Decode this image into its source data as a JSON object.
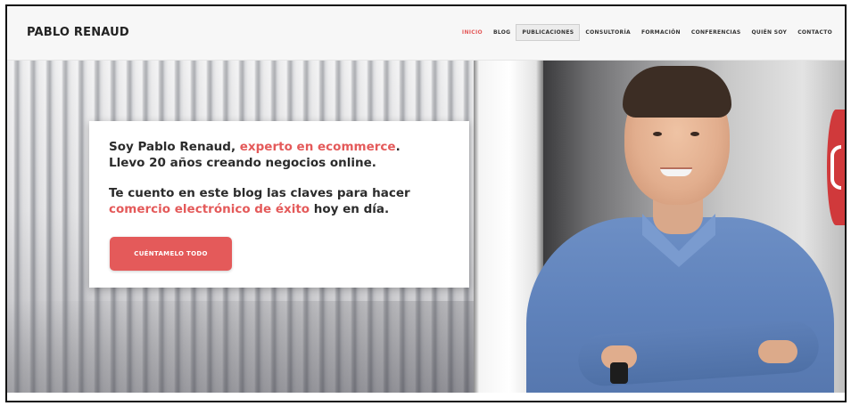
{
  "header": {
    "logo": "PABLO RENAUD",
    "nav": [
      {
        "label": "INICIO",
        "state": "active"
      },
      {
        "label": "BLOG",
        "state": "normal"
      },
      {
        "label": "PUBLICACIONES",
        "state": "hover"
      },
      {
        "label": "CONSULTORÍA",
        "state": "normal"
      },
      {
        "label": "FORMACIÓN",
        "state": "normal"
      },
      {
        "label": "CONFERENCIAS",
        "state": "normal"
      },
      {
        "label": "QUIÉN SOY",
        "state": "normal"
      },
      {
        "label": "CONTACTO",
        "state": "normal"
      }
    ]
  },
  "hero": {
    "line1_prefix": "Soy Pablo Renaud, ",
    "line1_accent": "experto en ecommerce",
    "line1_suffix": ".",
    "line2": "Llevo 20 años creando negocios online.",
    "line3": "Te cuento en este blog las claves para hacer",
    "line4_accent": "comercio electrónico de éxito",
    "line4_suffix": " hoy en día.",
    "cta_label": "CUÉNTAMELO TODO"
  },
  "colors": {
    "accent": "#e45a5a",
    "text": "#2b2b2b",
    "header_bg": "#f7f7f7"
  }
}
